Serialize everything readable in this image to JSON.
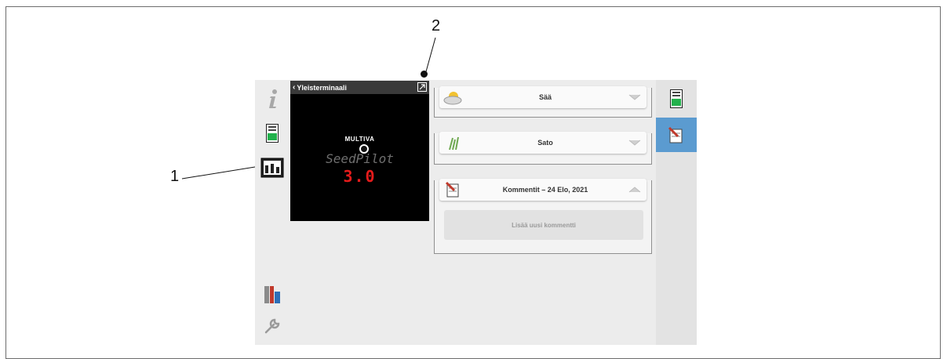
{
  "callouts": {
    "one": "1",
    "two": "2"
  },
  "vt": {
    "back_label": "Yleisterminaali",
    "brand": "MULTIVA",
    "product": "SeedPilot",
    "version": "3.0"
  },
  "widgets": [
    {
      "title": "Sää",
      "icon": "sun-cloud-icon",
      "chevron": "chevron-down-icon"
    },
    {
      "title": "Sato",
      "icon": "crop-icon",
      "chevron": "chevron-down-icon"
    },
    {
      "title": "Kommentit – 24 Elo, 2021",
      "icon": "notepad-pen-icon",
      "chevron": "chevron-up-icon",
      "add_label": "Lisää uusi kommentti"
    }
  ],
  "left_sidebar": [
    "info-icon",
    "terminal-icon",
    "layout-icon",
    "device-icon",
    "wrench-icon"
  ],
  "right_sidebar": [
    "terminal-icon",
    "notepad-pen-icon"
  ],
  "colors": {
    "active_tab": "#5b9bd0",
    "version_red": "#e51b1b",
    "screen_bg": "#ececec"
  }
}
